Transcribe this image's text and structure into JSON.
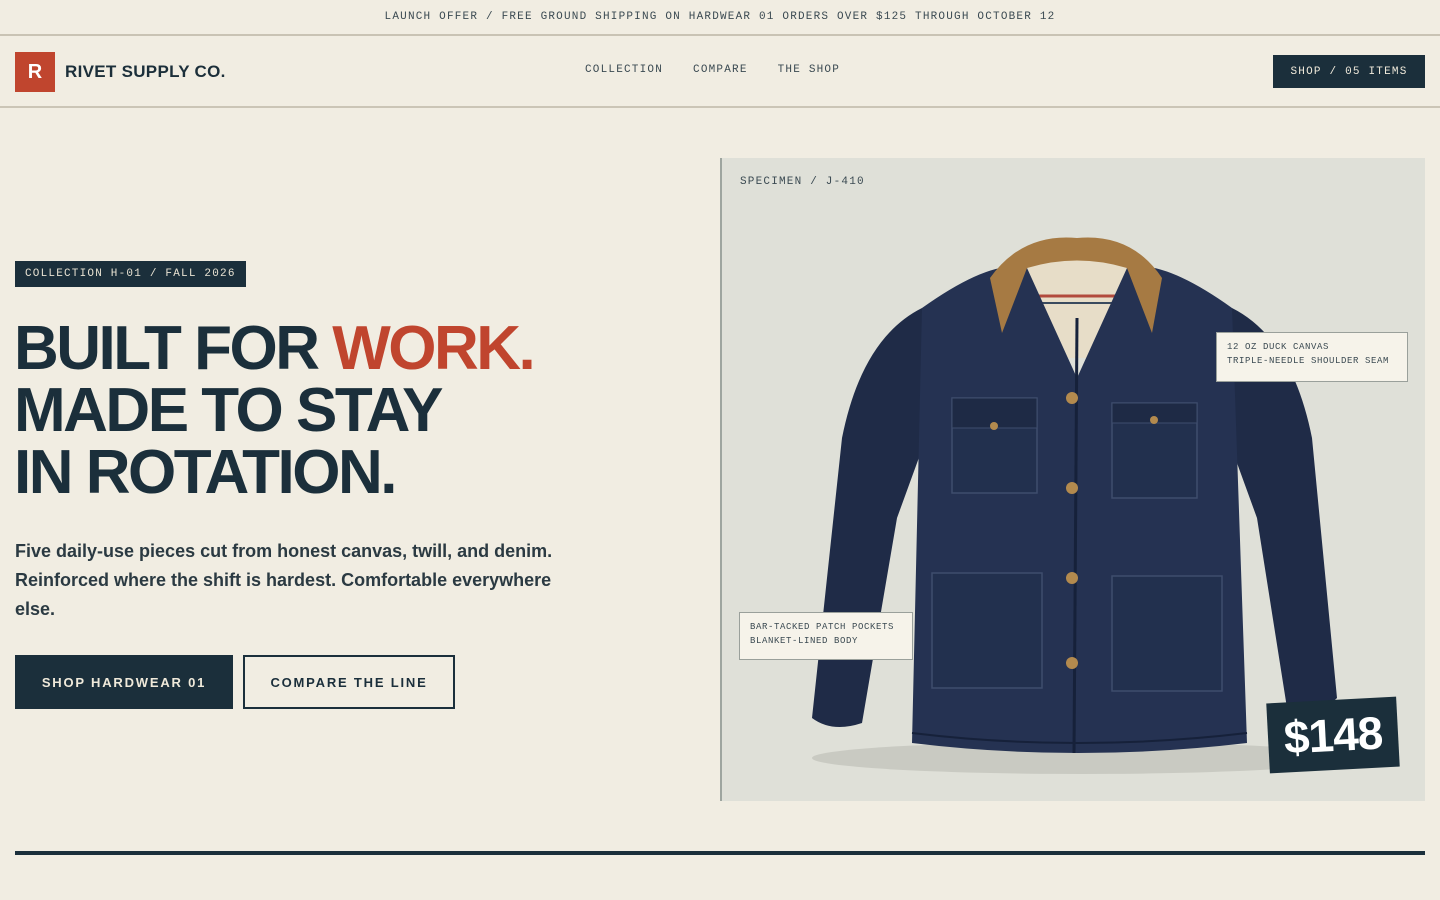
{
  "announcement": "LAUNCH OFFER / FREE GROUND SHIPPING ON HARDWEAR 01 ORDERS OVER $125 THROUGH OCTOBER 12",
  "brand": {
    "mark": "R",
    "name": "RIVET SUPPLY CO."
  },
  "nav": {
    "collection": "COLLECTION",
    "compare": "COMPARE",
    "shop": "THE SHOP"
  },
  "cart_label": "SHOP / 05 ITEMS",
  "hero": {
    "tag": "COLLECTION H-01 / FALL 2026",
    "headline_1a": "BUILT FOR ",
    "headline_1b": "WORK.",
    "headline_2": "MADE TO STAY",
    "headline_3": "IN ROTATION.",
    "lede": "Five daily-use pieces cut from honest canvas, twill, and denim. Reinforced where the shift is hardest. Comfortable everywhere else.",
    "primary_cta": "SHOP HARDWEAR 01",
    "secondary_cta": "COMPARE THE LINE"
  },
  "product": {
    "specimen": "SPECIMEN / J-410",
    "callout_1_line_1": "12 OZ DUCK CANVAS",
    "callout_1_line_2": "TRIPLE-NEEDLE SHOULDER SEAM",
    "callout_2_line_1": "BAR-TACKED PATCH POCKETS",
    "callout_2_line_2": "BLANKET-LINED BODY",
    "price": "$148"
  },
  "colors": {
    "background": "#f1ede2",
    "ink": "#1b2f3b",
    "accent": "#c0452e",
    "panel": "#dfe0d8"
  }
}
